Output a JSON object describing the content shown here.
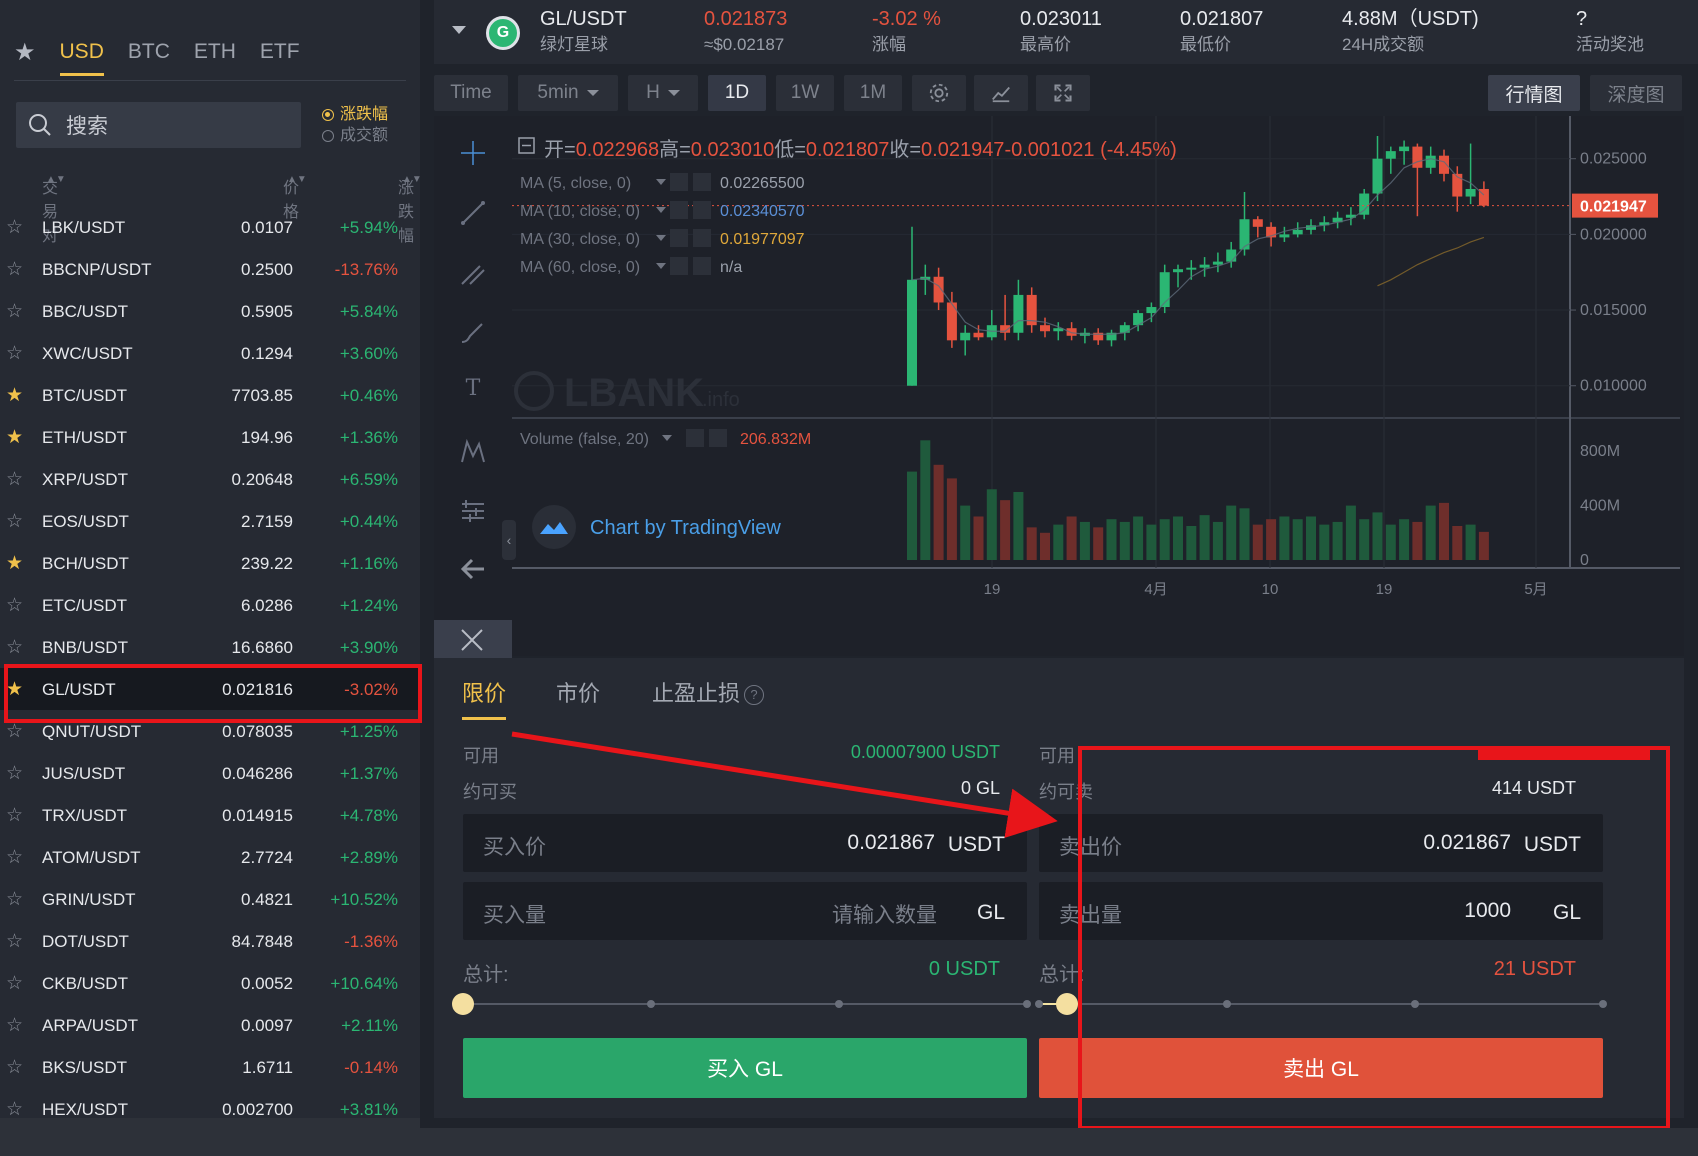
{
  "left": {
    "currency_tabs": [
      "USD",
      "BTC",
      "ETH",
      "ETF"
    ],
    "active_tab": "USD",
    "search_placeholder": "搜索",
    "sort_options": [
      "涨跌幅",
      "成交额"
    ],
    "columns": [
      "交易对",
      "价格",
      "涨跌幅"
    ],
    "pairs": [
      {
        "name": "LBK/USDT",
        "price": "0.0107",
        "change": "+5.94%",
        "up": true,
        "fav": false
      },
      {
        "name": "BBCNP/USDT",
        "price": "0.2500",
        "change": "-13.76%",
        "up": false,
        "fav": false
      },
      {
        "name": "BBC/USDT",
        "price": "0.5905",
        "change": "+5.84%",
        "up": true,
        "fav": false
      },
      {
        "name": "XWC/USDT",
        "price": "0.1294",
        "change": "+3.60%",
        "up": true,
        "fav": false
      },
      {
        "name": "BTC/USDT",
        "price": "7703.85",
        "change": "+0.46%",
        "up": true,
        "fav": true
      },
      {
        "name": "ETH/USDT",
        "price": "194.96",
        "change": "+1.36%",
        "up": true,
        "fav": true
      },
      {
        "name": "XRP/USDT",
        "price": "0.20648",
        "change": "+6.59%",
        "up": true,
        "fav": false
      },
      {
        "name": "EOS/USDT",
        "price": "2.7159",
        "change": "+0.44%",
        "up": true,
        "fav": false
      },
      {
        "name": "BCH/USDT",
        "price": "239.22",
        "change": "+1.16%",
        "up": true,
        "fav": true
      },
      {
        "name": "ETC/USDT",
        "price": "6.0286",
        "change": "+1.24%",
        "up": true,
        "fav": false
      },
      {
        "name": "BNB/USDT",
        "price": "16.6860",
        "change": "+3.90%",
        "up": true,
        "fav": false
      },
      {
        "name": "GL/USDT",
        "price": "0.021816",
        "change": "-3.02%",
        "up": false,
        "fav": true,
        "selected": true
      },
      {
        "name": "QNUT/USDT",
        "price": "0.078035",
        "change": "+1.25%",
        "up": true,
        "fav": false
      },
      {
        "name": "JUS/USDT",
        "price": "0.046286",
        "change": "+1.37%",
        "up": true,
        "fav": false
      },
      {
        "name": "TRX/USDT",
        "price": "0.014915",
        "change": "+4.78%",
        "up": true,
        "fav": false
      },
      {
        "name": "ATOM/USDT",
        "price": "2.7724",
        "change": "+2.89%",
        "up": true,
        "fav": false
      },
      {
        "name": "GRIN/USDT",
        "price": "0.4821",
        "change": "+10.52%",
        "up": true,
        "fav": false
      },
      {
        "name": "DOT/USDT",
        "price": "84.7848",
        "change": "-1.36%",
        "up": false,
        "fav": false
      },
      {
        "name": "CKB/USDT",
        "price": "0.0052",
        "change": "+10.64%",
        "up": true,
        "fav": false
      },
      {
        "name": "ARPA/USDT",
        "price": "0.0097",
        "change": "+2.11%",
        "up": true,
        "fav": false
      },
      {
        "name": "BKS/USDT",
        "price": "1.6711",
        "change": "-0.14%",
        "up": false,
        "fav": false
      },
      {
        "name": "HEX/USDT",
        "price": "0.002700",
        "change": "+3.81%",
        "up": true,
        "fav": false
      }
    ]
  },
  "ticker": {
    "pair": "GL/USDT",
    "name": "绿灯星球",
    "price": "0.021873",
    "price_usd": "≈$0.02187",
    "change": "-3.02 %",
    "change_label": "涨幅",
    "high": "0.023011",
    "high_label": "最高价",
    "low": "0.021807",
    "low_label": "最低价",
    "volume": "4.88M（USDT)",
    "volume_label": "24H成交额",
    "promo": "?",
    "promo_label": "活动奖池"
  },
  "toolbar": {
    "time": "Time",
    "interval": "5min",
    "chart_style": "H",
    "periods": [
      "1D",
      "1W",
      "1M"
    ],
    "active_period": "1D",
    "view_tabs": [
      "行情图",
      "深度图"
    ],
    "active_view": "行情图"
  },
  "chart": {
    "ohlc_text": {
      "open_label": "开=",
      "open": "0.022968",
      "high_label": "高=",
      "high": "0.023010",
      "low_label": "低=",
      "low": "0.021807",
      "close_label": "收=",
      "close": "0.021947",
      "change": "-0.001021 (-4.45%)"
    },
    "indicators": [
      {
        "label": "MA (5, close, 0)",
        "value": "0.02265500",
        "color": "#9aa0ab"
      },
      {
        "label": "MA (10, close, 0)",
        "value": "0.02340570",
        "color": "#5b8fd6"
      },
      {
        "label": "MA (30, close, 0)",
        "value": "0.01977097",
        "color": "#e0a83a"
      },
      {
        "label": "MA (60, close, 0)",
        "value": "n/a",
        "color": "#9aa0ab"
      }
    ],
    "volume_indicator": {
      "label": "Volume (false, 20)",
      "value": "206.832M"
    },
    "watermark": "LBANK",
    "watermark_suffix": ".info",
    "attribution": "Chart by TradingView",
    "current_price_tag": "0.021947",
    "price_axis": [
      "0.025000",
      "0.020000",
      "0.015000",
      "0.010000"
    ],
    "volume_axis": [
      "800M",
      "400M",
      "0"
    ],
    "time_axis": [
      "19",
      "4月",
      "10",
      "19",
      "5月"
    ]
  },
  "chart_data": {
    "type": "candlestick",
    "interval": "1D",
    "price_ylim": [
      0.008,
      0.0265
    ],
    "volume_ylim": [
      0,
      1000000000
    ],
    "candles": [
      {
        "o": 0.01,
        "h": 0.0205,
        "l": 0.01,
        "c": 0.017,
        "v": 650000000
      },
      {
        "o": 0.017,
        "h": 0.018,
        "l": 0.016,
        "c": 0.0172,
        "v": 880000000
      },
      {
        "o": 0.0172,
        "h": 0.0178,
        "l": 0.015,
        "c": 0.0155,
        "v": 700000000
      },
      {
        "o": 0.0155,
        "h": 0.0162,
        "l": 0.0125,
        "c": 0.013,
        "v": 600000000
      },
      {
        "o": 0.013,
        "h": 0.014,
        "l": 0.012,
        "c": 0.0135,
        "v": 400000000
      },
      {
        "o": 0.0135,
        "h": 0.014,
        "l": 0.013,
        "c": 0.0132,
        "v": 320000000
      },
      {
        "o": 0.0132,
        "h": 0.015,
        "l": 0.013,
        "c": 0.014,
        "v": 520000000
      },
      {
        "o": 0.014,
        "h": 0.016,
        "l": 0.013,
        "c": 0.0135,
        "v": 440000000
      },
      {
        "o": 0.0135,
        "h": 0.017,
        "l": 0.013,
        "c": 0.016,
        "v": 500000000
      },
      {
        "o": 0.016,
        "h": 0.0165,
        "l": 0.0135,
        "c": 0.014,
        "v": 240000000
      },
      {
        "o": 0.014,
        "h": 0.0145,
        "l": 0.0132,
        "c": 0.0136,
        "v": 200000000
      },
      {
        "o": 0.0136,
        "h": 0.0142,
        "l": 0.013,
        "c": 0.0138,
        "v": 260000000
      },
      {
        "o": 0.0138,
        "h": 0.0142,
        "l": 0.013,
        "c": 0.0133,
        "v": 320000000
      },
      {
        "o": 0.0133,
        "h": 0.0138,
        "l": 0.0128,
        "c": 0.0135,
        "v": 280000000
      },
      {
        "o": 0.0135,
        "h": 0.0138,
        "l": 0.0127,
        "c": 0.013,
        "v": 240000000
      },
      {
        "o": 0.013,
        "h": 0.0137,
        "l": 0.0126,
        "c": 0.0135,
        "v": 300000000
      },
      {
        "o": 0.0135,
        "h": 0.0142,
        "l": 0.013,
        "c": 0.014,
        "v": 280000000
      },
      {
        "o": 0.014,
        "h": 0.015,
        "l": 0.0136,
        "c": 0.0148,
        "v": 320000000
      },
      {
        "o": 0.0148,
        "h": 0.0155,
        "l": 0.0142,
        "c": 0.0152,
        "v": 260000000
      },
      {
        "o": 0.0152,
        "h": 0.018,
        "l": 0.0148,
        "c": 0.0175,
        "v": 300000000
      },
      {
        "o": 0.0175,
        "h": 0.018,
        "l": 0.0165,
        "c": 0.0177,
        "v": 320000000
      },
      {
        "o": 0.0177,
        "h": 0.0183,
        "l": 0.017,
        "c": 0.0178,
        "v": 250000000
      },
      {
        "o": 0.0178,
        "h": 0.0185,
        "l": 0.0172,
        "c": 0.018,
        "v": 330000000
      },
      {
        "o": 0.018,
        "h": 0.0188,
        "l": 0.0175,
        "c": 0.0182,
        "v": 280000000
      },
      {
        "o": 0.0182,
        "h": 0.0195,
        "l": 0.0178,
        "c": 0.019,
        "v": 400000000
      },
      {
        "o": 0.019,
        "h": 0.0228,
        "l": 0.0186,
        "c": 0.021,
        "v": 380000000
      },
      {
        "o": 0.021,
        "h": 0.0212,
        "l": 0.0198,
        "c": 0.0205,
        "v": 260000000
      },
      {
        "o": 0.0205,
        "h": 0.0208,
        "l": 0.0192,
        "c": 0.0198,
        "v": 300000000
      },
      {
        "o": 0.0198,
        "h": 0.0205,
        "l": 0.0195,
        "c": 0.02,
        "v": 320000000
      },
      {
        "o": 0.02,
        "h": 0.0208,
        "l": 0.0198,
        "c": 0.0203,
        "v": 300000000
      },
      {
        "o": 0.0203,
        "h": 0.021,
        "l": 0.02,
        "c": 0.0206,
        "v": 320000000
      },
      {
        "o": 0.0206,
        "h": 0.0212,
        "l": 0.0202,
        "c": 0.0208,
        "v": 260000000
      },
      {
        "o": 0.0208,
        "h": 0.0215,
        "l": 0.0204,
        "c": 0.0211,
        "v": 280000000
      },
      {
        "o": 0.0211,
        "h": 0.0218,
        "l": 0.0206,
        "c": 0.0213,
        "v": 400000000
      },
      {
        "o": 0.0213,
        "h": 0.023,
        "l": 0.021,
        "c": 0.0227,
        "v": 300000000
      },
      {
        "o": 0.0227,
        "h": 0.0265,
        "l": 0.0222,
        "c": 0.025,
        "v": 350000000
      },
      {
        "o": 0.025,
        "h": 0.0258,
        "l": 0.024,
        "c": 0.0255,
        "v": 260000000
      },
      {
        "o": 0.0255,
        "h": 0.0262,
        "l": 0.0246,
        "c": 0.0258,
        "v": 300000000
      },
      {
        "o": 0.0258,
        "h": 0.026,
        "l": 0.0212,
        "c": 0.0244,
        "v": 280000000
      },
      {
        "o": 0.0244,
        "h": 0.0258,
        "l": 0.024,
        "c": 0.0252,
        "v": 400000000
      },
      {
        "o": 0.0252,
        "h": 0.0256,
        "l": 0.0235,
        "c": 0.024,
        "v": 420000000
      },
      {
        "o": 0.024,
        "h": 0.0245,
        "l": 0.0215,
        "c": 0.0225,
        "v": 250000000
      },
      {
        "o": 0.0225,
        "h": 0.026,
        "l": 0.022,
        "c": 0.023,
        "v": 260000000
      },
      {
        "o": 0.023,
        "h": 0.0235,
        "l": 0.0218,
        "c": 0.0219,
        "v": 206832000
      }
    ],
    "ma5": [
      0.017,
      0.0171,
      0.0166,
      0.0154,
      0.0142,
      0.0137,
      0.0136,
      0.0136,
      0.0143,
      0.0143,
      0.0142,
      0.0139,
      0.0135,
      0.0134,
      0.0134,
      0.0134,
      0.0135,
      0.014,
      0.0145,
      0.0155,
      0.0163,
      0.0172,
      0.0177,
      0.0179,
      0.0182,
      0.0192,
      0.0197,
      0.0199,
      0.0202,
      0.0204,
      0.0205,
      0.0206,
      0.0208,
      0.021,
      0.0216,
      0.0226,
      0.0234,
      0.0244,
      0.0248,
      0.025,
      0.0248,
      0.0238,
      0.0234,
      0.0226
    ],
    "ma30": [
      null,
      null,
      null,
      null,
      null,
      null,
      null,
      null,
      null,
      null,
      null,
      null,
      null,
      null,
      null,
      null,
      null,
      null,
      null,
      null,
      null,
      null,
      null,
      null,
      null,
      null,
      null,
      null,
      null,
      null,
      null,
      null,
      null,
      null,
      null,
      0.0166,
      0.017,
      0.0175,
      0.018,
      0.0184,
      0.0188,
      0.0191,
      0.0195,
      0.0198
    ]
  },
  "order": {
    "tabs": [
      "限价",
      "市价",
      "止盈止损"
    ],
    "active_tab": "限价",
    "help_icon": "?",
    "buy": {
      "available_label": "可用",
      "available_value": "0.00007900 USDT",
      "can_buy_label": "约可买",
      "can_buy_value": "0 GL",
      "price_label": "买入价",
      "price_value": "0.021867",
      "price_unit": "USDT",
      "amount_label": "买入量",
      "amount_placeholder": "请输入数量",
      "amount_unit": "GL",
      "total_label": "总计:",
      "total_value": "0 USDT",
      "slider_fraction": 0,
      "button": "买入 GL"
    },
    "sell": {
      "available_label": "可用",
      "can_sell_label": "约可卖",
      "can_sell_value": "414 USDT",
      "price_label": "卖出价",
      "price_value": "0.021867",
      "price_unit": "USDT",
      "amount_label": "卖出量",
      "amount_value": "1000",
      "amount_unit": "GL",
      "total_label": "总计:",
      "total_value": "21 USDT",
      "slider_fraction": 0.05,
      "button": "卖出 GL"
    }
  },
  "colors": {
    "up": "#2bb673",
    "down": "#e5533f",
    "accent": "#f0c14b",
    "highlight": "#e8151a"
  }
}
